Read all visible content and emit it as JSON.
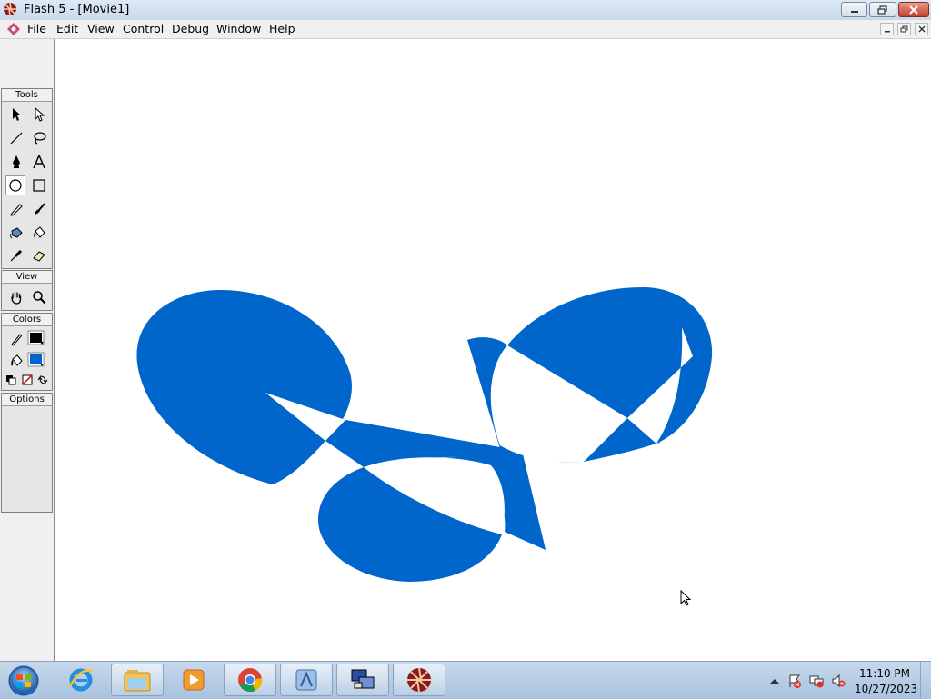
{
  "window": {
    "title": "Flash 5 - [Movie1]"
  },
  "menu": {
    "items": [
      "File",
      "Edit",
      "View",
      "Control",
      "Debug",
      "Window",
      "Help"
    ]
  },
  "panels": {
    "tools": "Tools",
    "view": "View",
    "colors": "Colors",
    "options": "Options"
  },
  "tools": [
    {
      "name": "arrow-tool-icon"
    },
    {
      "name": "subselect-tool-icon"
    },
    {
      "name": "line-tool-icon"
    },
    {
      "name": "lasso-tool-icon"
    },
    {
      "name": "pen-tool-icon"
    },
    {
      "name": "text-tool-icon"
    },
    {
      "name": "oval-tool-icon",
      "selected": true
    },
    {
      "name": "rectangle-tool-icon"
    },
    {
      "name": "pencil-tool-icon"
    },
    {
      "name": "brush-tool-icon"
    },
    {
      "name": "ink-bottle-tool-icon"
    },
    {
      "name": "paint-bucket-tool-icon"
    },
    {
      "name": "dropper-tool-icon"
    },
    {
      "name": "eraser-tool-icon"
    },
    {
      "name": "hand-tool-icon"
    },
    {
      "name": "zoom-tool-icon"
    }
  ],
  "colors": {
    "stroke": "#000000",
    "fill": "#0066cc",
    "stage_shape_fill": "#0066cc"
  },
  "taskbar": {
    "apps": [
      "internet-explorer-icon",
      "file-explorer-icon",
      "media-player-icon",
      "chrome-icon",
      "app-icon",
      "network-app-icon",
      "flash-icon"
    ],
    "clock_time": "11:10 PM",
    "clock_date": "10/27/2023"
  }
}
